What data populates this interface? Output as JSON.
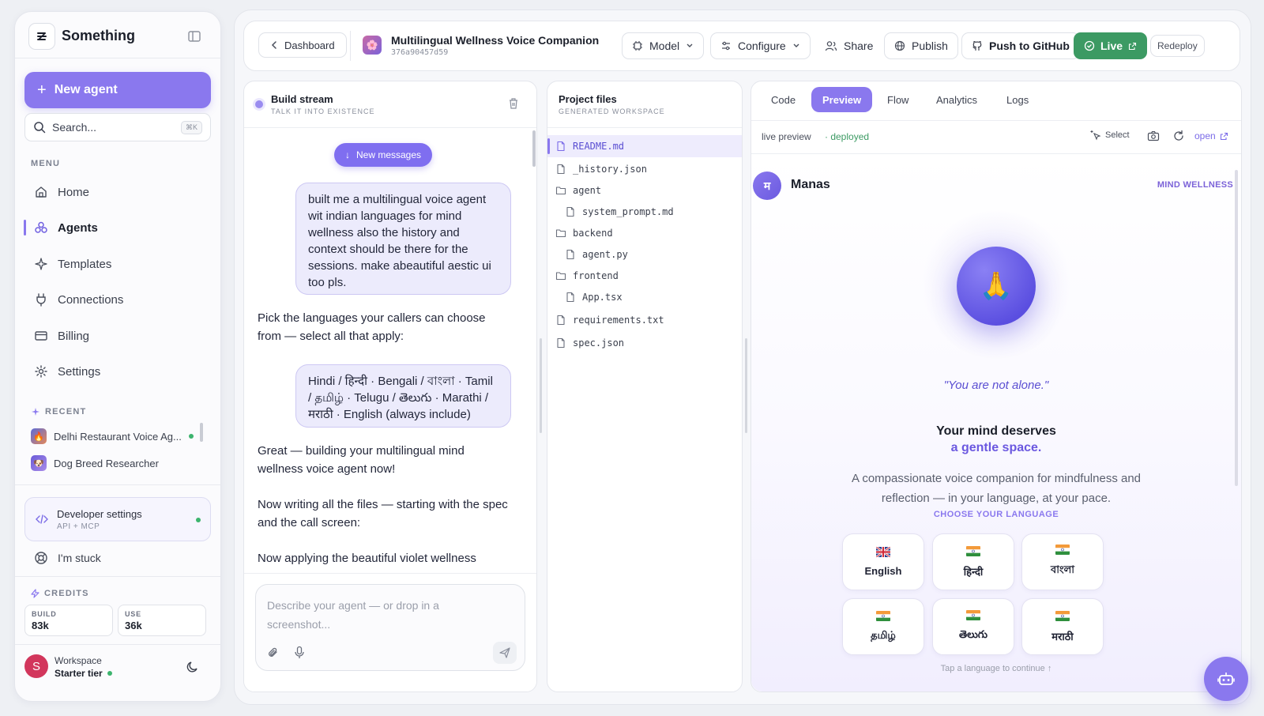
{
  "app": {
    "name": "Something"
  },
  "sidebar": {
    "new_agent": "New agent",
    "search_placeholder": "Search...",
    "search_kbd": "⌘K",
    "menu_label": "MENU",
    "items": [
      {
        "label": "Home",
        "icon": "home-icon"
      },
      {
        "label": "Agents",
        "icon": "agents-icon",
        "active": true
      },
      {
        "label": "Templates",
        "icon": "sparkle-icon"
      },
      {
        "label": "Connections",
        "icon": "plug-icon"
      },
      {
        "label": "Billing",
        "icon": "card-icon"
      },
      {
        "label": "Settings",
        "icon": "gear-icon"
      }
    ],
    "recent_label": "RECENT",
    "recent": [
      {
        "label": "Delhi Restaurant Voice Ag...",
        "status": "online"
      },
      {
        "label": "Dog Breed Researcher"
      }
    ],
    "dev_settings": {
      "title": "Developer settings",
      "subtitle": "API + MCP"
    },
    "stuck": "I'm stuck",
    "credits_label": "CREDITS",
    "credits": [
      {
        "label": "BUILD",
        "value": "83k"
      },
      {
        "label": "USE",
        "value": "36k"
      }
    ],
    "workspace": {
      "initial": "S",
      "name": "Workspace",
      "tier": "Starter tier"
    }
  },
  "topbar": {
    "back": "Dashboard",
    "project_title": "Multilingual Wellness Voice Companion",
    "project_id": "376a90457d59",
    "model": "Model",
    "configure": "Configure",
    "share": "Share",
    "publish": "Publish",
    "push": "Push to GitHub",
    "live": "Live",
    "redeploy": "Redeploy"
  },
  "build_stream": {
    "title": "Build stream",
    "subtitle": "TALK IT INTO EXISTENCE",
    "new_messages": "New messages",
    "messages": [
      {
        "role": "user",
        "text": "built me a multilingual voice agent wit indian languages for mind wellness also the history and context should be there for the sessions. make abeautiful aestic ui too pls."
      },
      {
        "role": "bot",
        "text": "Pick the languages your callers can choose from — select all that apply:"
      },
      {
        "role": "user",
        "text": "Hindi / हिन्दी · Bengali / বাংলা · Tamil / தமிழ் · Telugu / తెలుగు · Marathi / मराठी · English (always include)"
      },
      {
        "role": "bot",
        "text": "Great — building your multilingual mind wellness voice agent now!"
      },
      {
        "role": "bot",
        "text": "Now writing all the files — starting with the spec and the call screen:"
      },
      {
        "role": "bot",
        "text": "Now applying the beautiful violet wellness"
      }
    ],
    "input_placeholder": "Describe your agent — or drop in a screenshot..."
  },
  "files": {
    "title": "Project files",
    "subtitle": "GENERATED WORKSPACE",
    "tree": [
      {
        "name": "README.md",
        "type": "file",
        "depth": 0,
        "selected": true
      },
      {
        "name": "_history.json",
        "type": "file",
        "depth": 0
      },
      {
        "name": "agent",
        "type": "folder",
        "depth": 0
      },
      {
        "name": "system_prompt.md",
        "type": "file",
        "depth": 1
      },
      {
        "name": "backend",
        "type": "folder",
        "depth": 0
      },
      {
        "name": "agent.py",
        "type": "file",
        "depth": 1
      },
      {
        "name": "frontend",
        "type": "folder",
        "depth": 0
      },
      {
        "name": "App.tsx",
        "type": "file",
        "depth": 1
      },
      {
        "name": "requirements.txt",
        "type": "file",
        "depth": 0
      },
      {
        "name": "spec.json",
        "type": "file",
        "depth": 0
      }
    ]
  },
  "preview": {
    "tabs": [
      "Code",
      "Preview",
      "Flow",
      "Analytics",
      "Logs"
    ],
    "active_tab": "Preview",
    "status_label": "live preview",
    "status_value": "· deployed",
    "select": "Select",
    "open": "open",
    "app": {
      "avatar_letter": "म",
      "name": "Manas",
      "tag": "MIND WELLNESS",
      "orb_emoji": "🙏",
      "quote": "\"You are not alone.\"",
      "headline_1": "Your mind deserves",
      "headline_2": "a gentle space.",
      "description": "A compassionate voice companion for mindfulness and reflection — in your language, at your pace.",
      "choose_label": "CHOOSE YOUR LANGUAGE",
      "languages": [
        {
          "name": "English",
          "flag": "uk"
        },
        {
          "name": "हिन्दी",
          "flag": "india"
        },
        {
          "name": "বাংলা",
          "flag": "india"
        },
        {
          "name": "தமிழ்",
          "flag": "india"
        },
        {
          "name": "తెలుగు",
          "flag": "india"
        },
        {
          "name": "मराठी",
          "flag": "india"
        }
      ],
      "hint": "Tap a language to continue ↑"
    }
  },
  "colors": {
    "accent": "#8a78ee",
    "live_green": "#3c9a63",
    "deployed_green": "#3c9a63"
  }
}
